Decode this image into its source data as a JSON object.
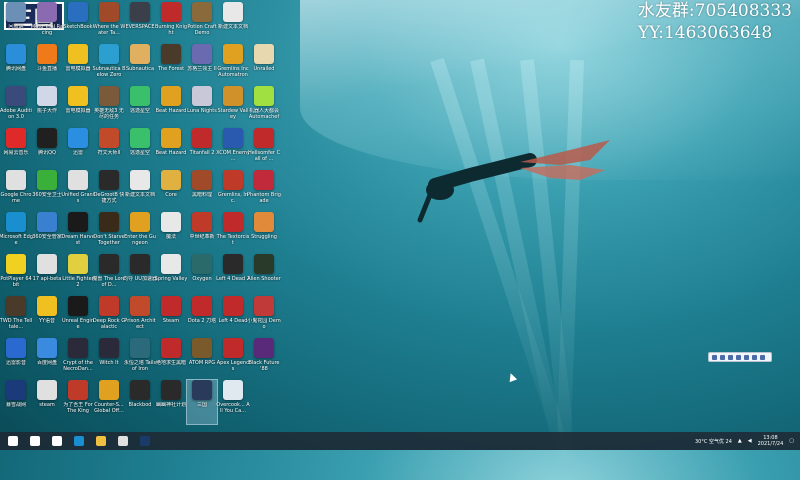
{
  "overlay": {
    "logo_text": "三国",
    "line1": "水友群:705408333",
    "line2": "YY:1463063648"
  },
  "desktop_icons": [
    {
      "label": "回收站",
      "col": 0,
      "row": 0,
      "color": "#6b8fb5"
    },
    {
      "label": "Moto Trial Racing",
      "col": 1,
      "row": 0,
      "color": "#8a6ab0"
    },
    {
      "label": "SketchBook",
      "col": 2,
      "row": 0,
      "color": "#2a6fbf"
    },
    {
      "label": "Where the Water Ta...",
      "col": 3,
      "row": 0,
      "color": "#a04a2a"
    },
    {
      "label": "EVERSPACE",
      "col": 4,
      "row": 0,
      "color": "#3a3f4a"
    },
    {
      "label": "Burning Knight",
      "col": 5,
      "row": 0,
      "color": "#c02a2a"
    },
    {
      "label": "Potion Craft Demo",
      "col": 6,
      "row": 0,
      "color": "#8a6a3a"
    },
    {
      "label": "新建文本文档",
      "col": 7,
      "row": 0,
      "color": "#e8e8e8"
    },
    {
      "label": "腾讯网盘",
      "col": 0,
      "row": 1,
      "color": "#2a8fd8"
    },
    {
      "label": "斗鱼直播",
      "col": 1,
      "row": 1,
      "color": "#f07a1a"
    },
    {
      "label": "雷电模拟器",
      "col": 2,
      "row": 1,
      "color": "#f0c020"
    },
    {
      "label": "Subnautica Below Zero",
      "col": 3,
      "row": 1,
      "color": "#2a9fd0"
    },
    {
      "label": "Subnautica",
      "col": 4,
      "row": 1,
      "color": "#e0b060"
    },
    {
      "label": "The Forest",
      "col": 5,
      "row": 1,
      "color": "#4a3a2a"
    },
    {
      "label": "苏格兰领主 II",
      "col": 6,
      "row": 1,
      "color": "#6a6ab0"
    },
    {
      "label": "Gremlins Inc Automatron",
      "col": 7,
      "row": 1,
      "color": "#e0a020"
    },
    {
      "label": "Unrailed",
      "col": 8,
      "row": 1,
      "color": "#e8d8b0"
    },
    {
      "label": "Adobe Audition 3.0",
      "col": 0,
      "row": 2,
      "color": "#3a4a7a"
    },
    {
      "label": "桃子大作",
      "col": 1,
      "row": 2,
      "color": "#d0d8e8"
    },
    {
      "label": "雷电模拟器",
      "col": 2,
      "row": 2,
      "color": "#f0c020"
    },
    {
      "label": "英雄无敌3 无尽的任务",
      "col": 3,
      "row": 2,
      "color": "#7a5a3a"
    },
    {
      "label": "逃逸星空",
      "col": 4,
      "row": 2,
      "color": "#3ac06a"
    },
    {
      "label": "Beat Hazard",
      "col": 5,
      "row": 2,
      "color": "#e0a020"
    },
    {
      "label": "Luna Nights",
      "col": 6,
      "row": 2,
      "color": "#c8c8d8"
    },
    {
      "label": "Stardew Valley",
      "col": 7,
      "row": 2,
      "color": "#d0902a"
    },
    {
      "label": "机器人大都会 Automachef",
      "col": 8,
      "row": 2,
      "color": "#a0e040"
    },
    {
      "label": "网易云音乐",
      "col": 0,
      "row": 3,
      "color": "#e02a2a"
    },
    {
      "label": "腾讯QQ",
      "col": 1,
      "row": 3,
      "color": "#202020"
    },
    {
      "label": "迅雷",
      "col": 2,
      "row": 3,
      "color": "#2a8fe0"
    },
    {
      "label": "符文大师II",
      "col": 3,
      "row": 3,
      "color": "#c04a2a"
    },
    {
      "label": "逃逸星空",
      "col": 4,
      "row": 3,
      "color": "#3ac06a"
    },
    {
      "label": "Beat Hazard",
      "col": 5,
      "row": 3,
      "color": "#e0a020"
    },
    {
      "label": "Titanfall 2",
      "col": 6,
      "row": 3,
      "color": "#c02a2a"
    },
    {
      "label": "XCOM Enemy ...",
      "col": 7,
      "row": 3,
      "color": "#2a5ab0"
    },
    {
      "label": "Hellsomfer Call of ...",
      "col": 8,
      "row": 3,
      "color": "#c02a2a"
    },
    {
      "label": "Google Chrome",
      "col": 0,
      "row": 4,
      "color": "#e0e0e0"
    },
    {
      "label": "360安全卫士",
      "col": 1,
      "row": 4,
      "color": "#3ab03a"
    },
    {
      "label": "Unified Grants",
      "col": 2,
      "row": 4,
      "color": "#e0e0e0"
    },
    {
      "label": "DeGrootB 快捷方式",
      "col": 3,
      "row": 4,
      "color": "#2a2a2a"
    },
    {
      "label": "新建文本文档",
      "col": 4,
      "row": 4,
      "color": "#e8e8e8"
    },
    {
      "label": "Core",
      "col": 5,
      "row": 4,
      "color": "#e0b040"
    },
    {
      "label": "黑暗料理",
      "col": 6,
      "row": 4,
      "color": "#a04a2a"
    },
    {
      "label": "Gremlins, Inc.",
      "col": 7,
      "row": 4,
      "color": "#c03a2a"
    },
    {
      "label": "Phantom Brigade",
      "col": 8,
      "row": 4,
      "color": "#c02a3a"
    },
    {
      "label": "Microsoft Edge",
      "col": 0,
      "row": 5,
      "color": "#1a8fd0"
    },
    {
      "label": "360安全管家",
      "col": 1,
      "row": 5,
      "color": "#3a80d0"
    },
    {
      "label": "Dream Harvest",
      "col": 2,
      "row": 5,
      "color": "#1a1a1a"
    },
    {
      "label": "Don't Starve Together",
      "col": 3,
      "row": 5,
      "color": "#3a2a1a"
    },
    {
      "label": "Enter the Gungeon",
      "col": 4,
      "row": 5,
      "color": "#e0a020"
    },
    {
      "label": "魔法",
      "col": 5,
      "row": 5,
      "color": "#e8e8e8"
    },
    {
      "label": "中世纪革新",
      "col": 6,
      "row": 5,
      "color": "#c03a2a"
    },
    {
      "label": "The Textorcist",
      "col": 7,
      "row": 5,
      "color": "#c02a2a"
    },
    {
      "label": "Struggling",
      "col": 8,
      "row": 5,
      "color": "#e08a3a"
    },
    {
      "label": "PotPlayer 64 bit",
      "col": 0,
      "row": 6,
      "color": "#f0d020"
    },
    {
      "label": "17 api-beta",
      "col": 1,
      "row": 6,
      "color": "#e0e0e0"
    },
    {
      "label": "Little Fighter 2",
      "col": 2,
      "row": 6,
      "color": "#e0d040"
    },
    {
      "label": "魔兽 The Lord of D...",
      "col": 3,
      "row": 6,
      "color": "#2a2a2a"
    },
    {
      "label": "向导 UU加速器",
      "col": 4,
      "row": 6,
      "color": "#2a2a2a"
    },
    {
      "label": "Spring Valley",
      "col": 5,
      "row": 6,
      "color": "#e8e8e8"
    },
    {
      "label": "Oxygen",
      "col": 6,
      "row": 6,
      "color": "#2a6a6a"
    },
    {
      "label": "Left 4 Dead 2",
      "col": 7,
      "row": 6,
      "color": "#2a2a2a"
    },
    {
      "label": "Alien Shooter",
      "col": 8,
      "row": 6,
      "color": "#2a3a2a"
    },
    {
      "label": "TWD The Telltale...",
      "col": 0,
      "row": 7,
      "color": "#4a3a2a"
    },
    {
      "label": "YY语音",
      "col": 1,
      "row": 7,
      "color": "#f0c020"
    },
    {
      "label": "Unreal Engine",
      "col": 2,
      "row": 7,
      "color": "#1a1a1a"
    },
    {
      "label": "Deep Rock Galactic",
      "col": 3,
      "row": 7,
      "color": "#c03a2a"
    },
    {
      "label": "Prison Architect",
      "col": 4,
      "row": 7,
      "color": "#c04a2a"
    },
    {
      "label": "Steam",
      "col": 5,
      "row": 7,
      "color": "#c02a2a"
    },
    {
      "label": "Dota 2 刀塔",
      "col": 6,
      "row": 7,
      "color": "#c02a2a"
    },
    {
      "label": "Left 4 Dead",
      "col": 7,
      "row": 7,
      "color": "#c02a2a"
    },
    {
      "label": "小鬼花园 Demo",
      "col": 8,
      "row": 7,
      "color": "#c03a3a"
    },
    {
      "label": "迅雷影音",
      "col": 0,
      "row": 8,
      "color": "#2a6ad0"
    },
    {
      "label": "百度网盘",
      "col": 1,
      "row": 8,
      "color": "#3a8ae0"
    },
    {
      "label": "Crypt of the NecroDan...",
      "col": 2,
      "row": 8,
      "color": "#2a2a3a"
    },
    {
      "label": "Witch It",
      "col": 3,
      "row": 8,
      "color": "#2a2a3a"
    },
    {
      "label": "永恒之塔 Tails of Iron",
      "col": 4,
      "row": 8,
      "color": "#2a6a7a"
    },
    {
      "label": "绝地求生黑暗",
      "col": 5,
      "row": 8,
      "color": "#c02a2a"
    },
    {
      "label": "ATOM RPG",
      "col": 6,
      "row": 8,
      "color": "#7a5a2a"
    },
    {
      "label": "Apex Legends",
      "col": 7,
      "row": 8,
      "color": "#c02a2a"
    },
    {
      "label": "Black Future '88",
      "col": 8,
      "row": 8,
      "color": "#5a2a7a"
    },
    {
      "label": "暴雪战网",
      "col": 0,
      "row": 9,
      "color": "#1a3a7a"
    },
    {
      "label": "steam",
      "col": 1,
      "row": 9,
      "color": "#e0e0e0"
    },
    {
      "label": "为了吾王 For The King",
      "col": 2,
      "row": 9,
      "color": "#c03a2a"
    },
    {
      "label": "Counter-S... Global Off...",
      "col": 3,
      "row": 9,
      "color": "#e0a020"
    },
    {
      "label": "Blackbod",
      "col": 4,
      "row": 9,
      "color": "#2a2a2a"
    },
    {
      "label": "幽幽神社计划",
      "col": 5,
      "row": 9,
      "color": "#2a2a2a"
    },
    {
      "label": "三国",
      "col": 6,
      "row": 9,
      "color": "#2a3a5a",
      "selected": true
    },
    {
      "label": "Overcook... All You Ca...",
      "col": 7,
      "row": 9,
      "color": "#e0e8f0"
    }
  ],
  "taskbar": {
    "items": [
      {
        "name": "start-icon",
        "color": "#ffffff"
      },
      {
        "name": "search-icon",
        "color": "#ffffff"
      },
      {
        "name": "task-view-icon",
        "color": "#ffffff"
      },
      {
        "name": "edge-icon",
        "color": "#1a8fd0"
      },
      {
        "name": "file-explorer-icon",
        "color": "#f0c040"
      },
      {
        "name": "chrome-icon",
        "color": "#e0e0e0"
      },
      {
        "name": "steam-icon",
        "color": "#1a3a6a"
      }
    ],
    "weather": "30°C 空气优 24",
    "time": "13:08",
    "date": "2021/7/24"
  }
}
